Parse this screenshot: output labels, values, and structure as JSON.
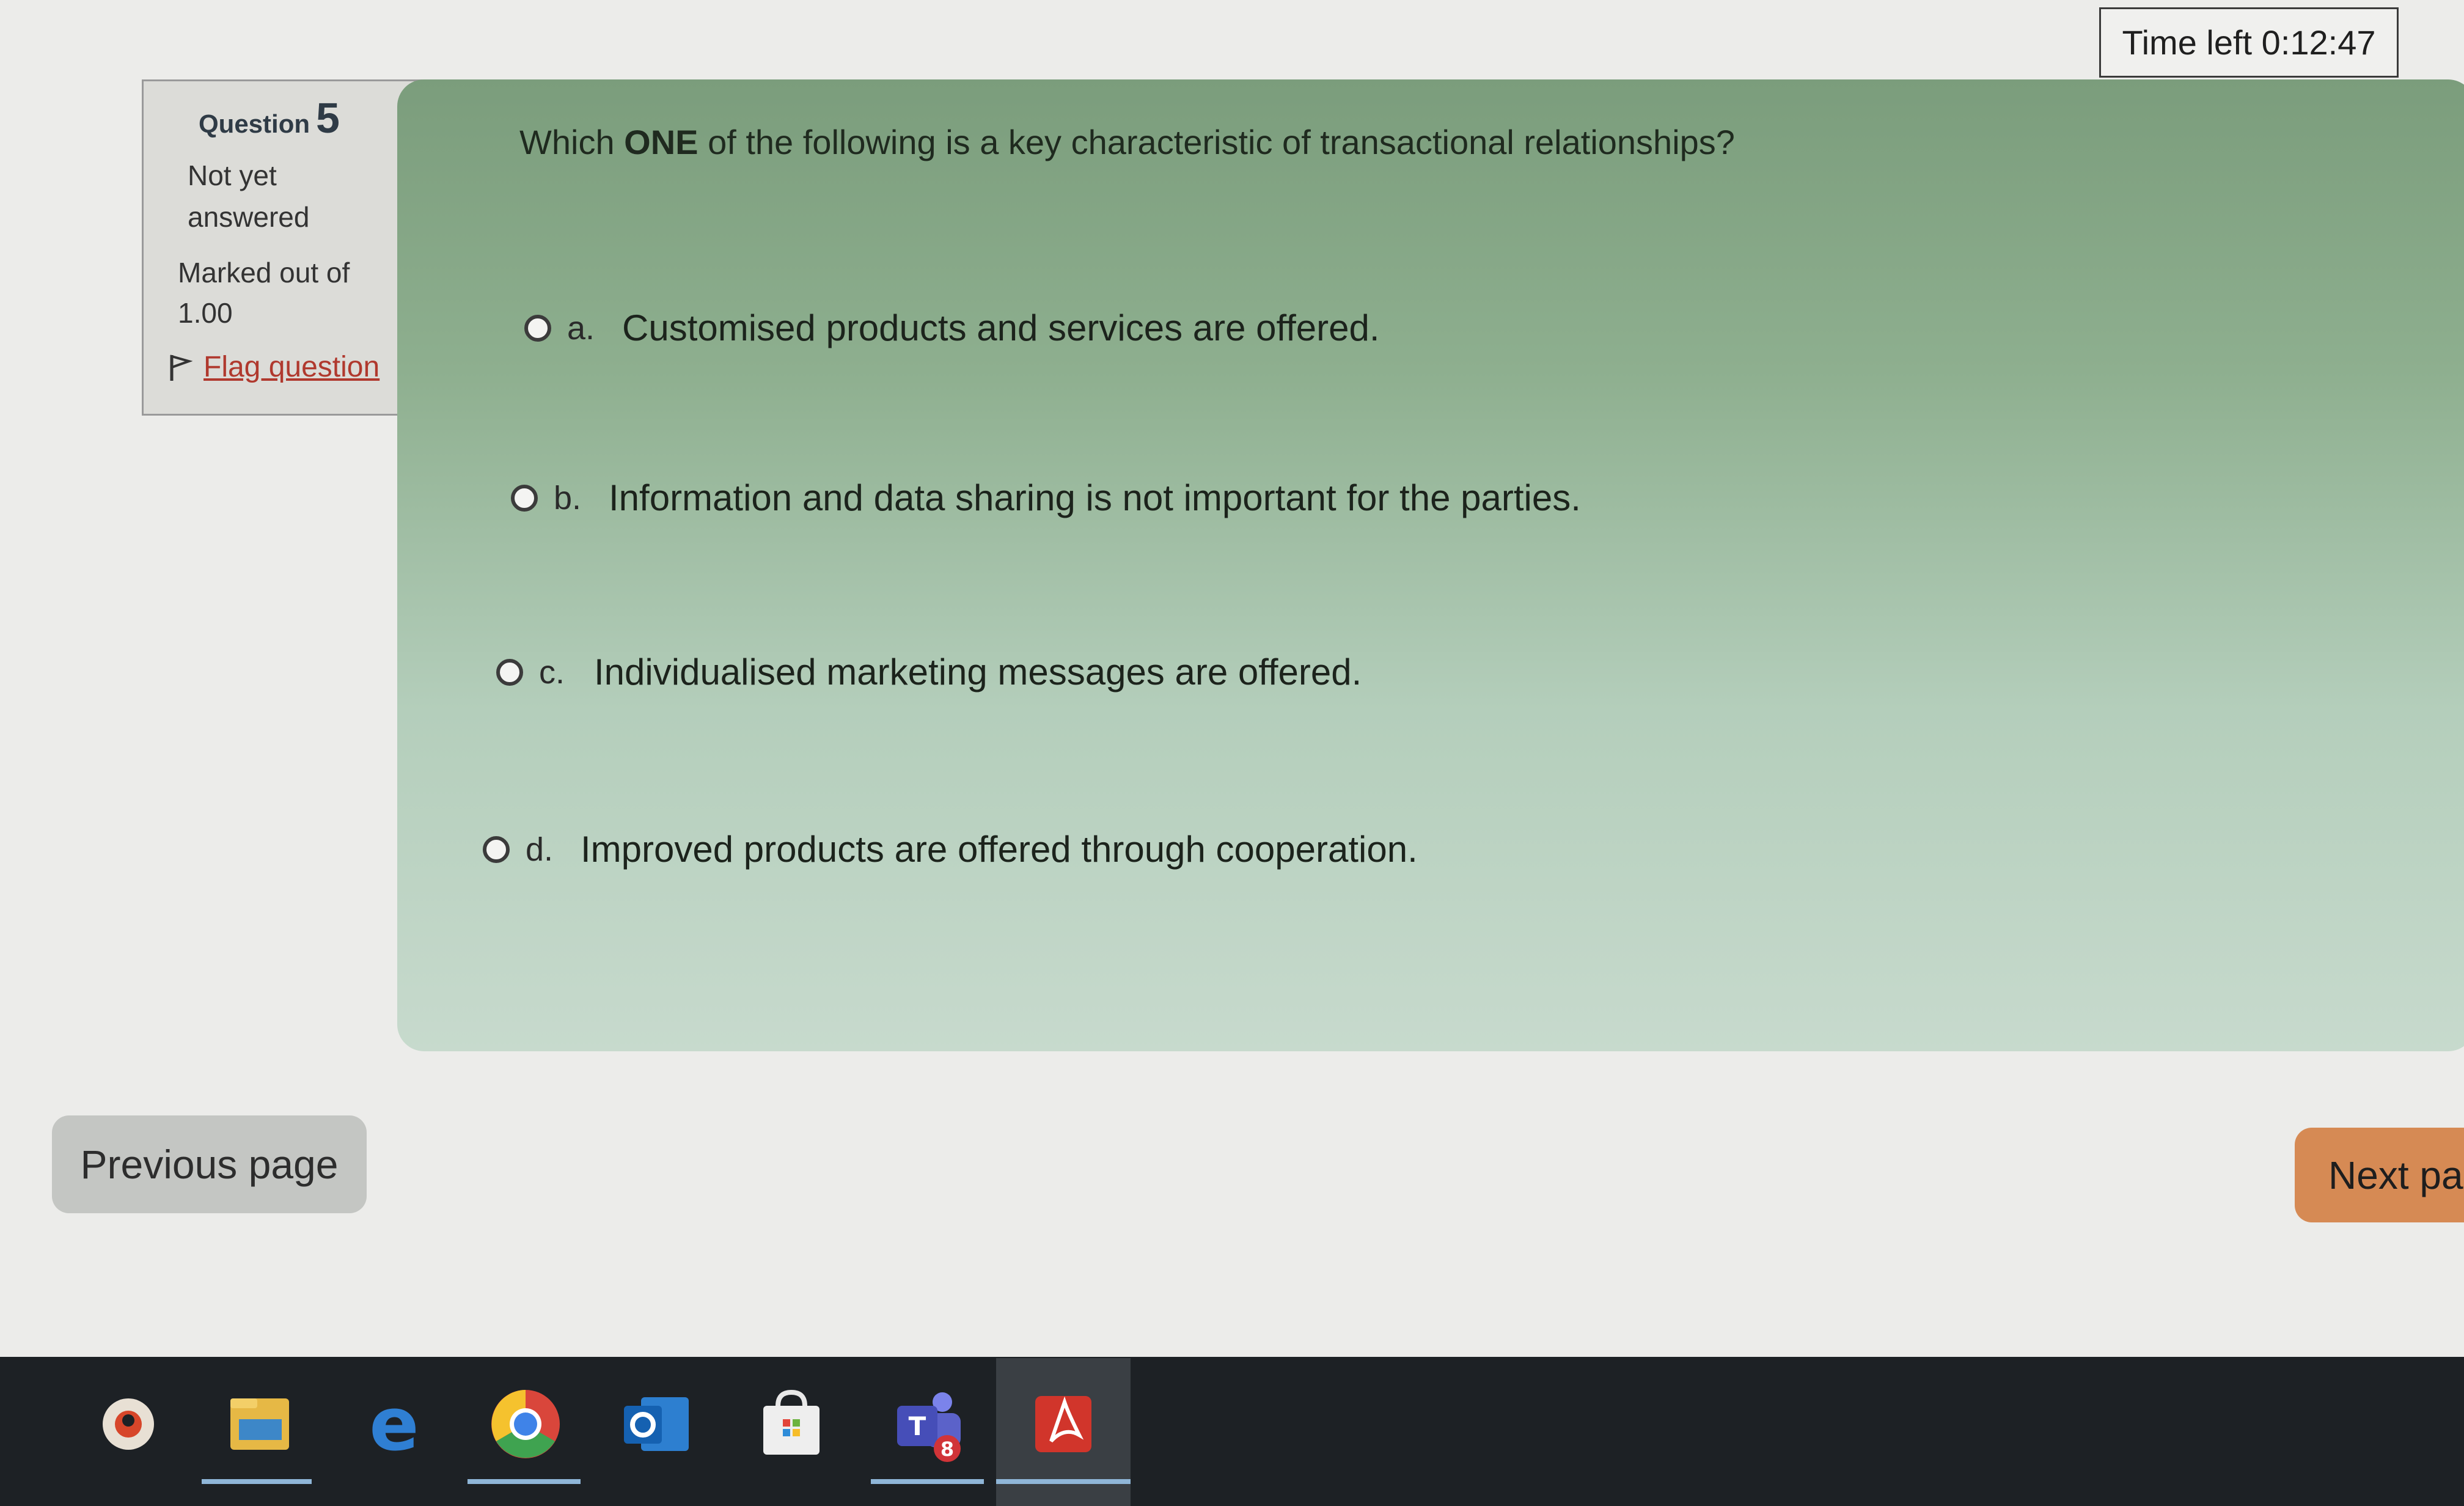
{
  "timer": {
    "label": "Time left 0:12:47"
  },
  "info": {
    "question_label": "Question",
    "question_number": "5",
    "status": "Not yet answered",
    "marked_out_of": "Marked out of 1.00",
    "flag_label": "Flag question"
  },
  "question": {
    "text_before": "Which ",
    "text_bold": "ONE",
    "text_after": " of the following is a key characteristic of transactional relationships?",
    "options": [
      {
        "letter": "a.",
        "text": "Customised products and services are offered."
      },
      {
        "letter": "b.",
        "text": "Information and data sharing is not important for the parties."
      },
      {
        "letter": "c.",
        "text": "Individualised marketing messages are offered."
      },
      {
        "letter": "d.",
        "text": "Improved products are offered through cooperation."
      }
    ]
  },
  "nav": {
    "previous": "Previous page",
    "next": "Next pa"
  },
  "taskbar": {
    "icons": [
      "edge-legacy-icon",
      "file-explorer-icon",
      "internet-explorer-icon",
      "chrome-icon",
      "outlook-icon",
      "store-icon",
      "teams-icon",
      "acrobat-icon"
    ],
    "teams_badge": "8"
  },
  "colors": {
    "accent_next": "#d68a54",
    "content_green": "#8eaf8f",
    "flag_link": "#b0392e"
  }
}
